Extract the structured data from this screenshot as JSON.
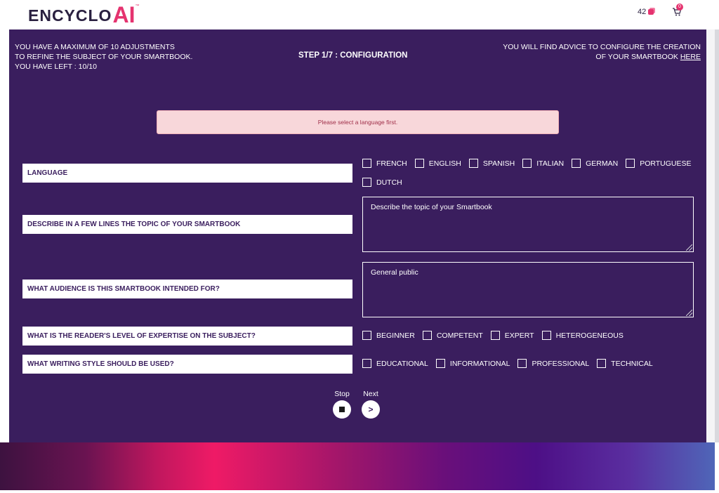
{
  "header": {
    "logo_text": "ENCYCLO",
    "logo_ai": "AI",
    "logo_tm": "™",
    "credits_count": "42",
    "cart_count": "0"
  },
  "config": {
    "info_left_line1": "YOU HAVE A MAXIMUM OF 10 ADJUSTMENTS",
    "info_left_line2": "TO REFINE THE SUBJECT OF YOUR SMARTBOOK.",
    "info_left_line3": "YOU HAVE LEFT : 10/10",
    "step_title": "STEP 1/7 : CONFIGURATION",
    "info_right_line1": "YOU WILL FIND ADVICE TO CONFIGURE THE CREATION",
    "info_right_line2_prefix": "OF YOUR SMARTBOOK ",
    "info_right_link": "HERE",
    "alert": "Please select a language first."
  },
  "questions": {
    "language": {
      "label": "LANGUAGE",
      "options": [
        "FRENCH",
        "ENGLISH",
        "SPANISH",
        "ITALIAN",
        "GERMAN",
        "PORTUGUESE",
        "DUTCH"
      ]
    },
    "topic": {
      "label": "DESCRIBE IN A FEW LINES THE TOPIC OF YOUR SMARTBOOK",
      "value": "Describe the topic of your Smartbook"
    },
    "audience": {
      "label": "WHAT AUDIENCE IS THIS SMARTBOOK INTENDED FOR?",
      "value": "General public"
    },
    "expertise": {
      "label": "WHAT IS THE READER'S LEVEL OF EXPERTISE ON THE SUBJECT?",
      "options": [
        "BEGINNER",
        "COMPETENT",
        "EXPERT",
        "HETEROGENEOUS"
      ]
    },
    "style": {
      "label": "WHAT WRITING STYLE SHOULD BE USED?",
      "options": [
        "EDUCATIONAL",
        "INFORMATIONAL",
        "PROFESSIONAL",
        "TECHNICAL"
      ]
    }
  },
  "controls": {
    "stop_label": "Stop",
    "next_label": "Next",
    "next_glyph": ">"
  },
  "colors": {
    "panel": "#3a1e5e",
    "accent": "#e5336f",
    "alert_bg": "#f8d7da"
  }
}
